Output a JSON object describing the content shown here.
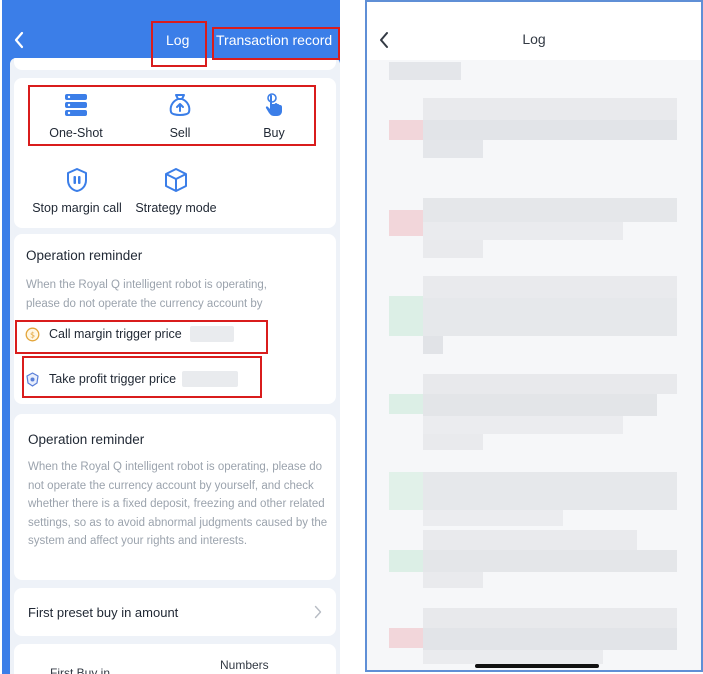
{
  "left": {
    "tabs": {
      "log": "Log",
      "transaction_record": "Transaction record"
    },
    "actions": [
      {
        "label": "One-Shot",
        "icon": "stack-icon"
      },
      {
        "label": "Sell",
        "icon": "money-bag-icon"
      },
      {
        "label": "Buy",
        "icon": "hand-pointer-icon"
      },
      {
        "label": "Stop margin call",
        "icon": "pause-shield-icon"
      },
      {
        "label": "Strategy mode",
        "icon": "cube-icon"
      }
    ],
    "reminder1": {
      "title": "Operation reminder",
      "text": "When the Royal Q intelligent robot is operating, please do not operate the currency account by",
      "call_margin_label": "Call margin trigger price",
      "take_profit_label": "Take profit trigger price"
    },
    "reminder2": {
      "title": "Operation reminder",
      "text": "When the Royal Q intelligent robot is operating, please do not operate the currency account by yourself, and check whether there is a fixed deposit, freezing and other related settings, so as to avoid abnormal judgments caused by the system and affect your rights and interests."
    },
    "first_preset": "First preset buy in amount",
    "bottom_labels": {
      "first_buy": "First Buy in",
      "numbers": "Numbers"
    }
  },
  "right": {
    "title": "Log"
  },
  "colors": {
    "brand_blue": "#3b7ee8",
    "highlight_red": "#d91c1c"
  }
}
